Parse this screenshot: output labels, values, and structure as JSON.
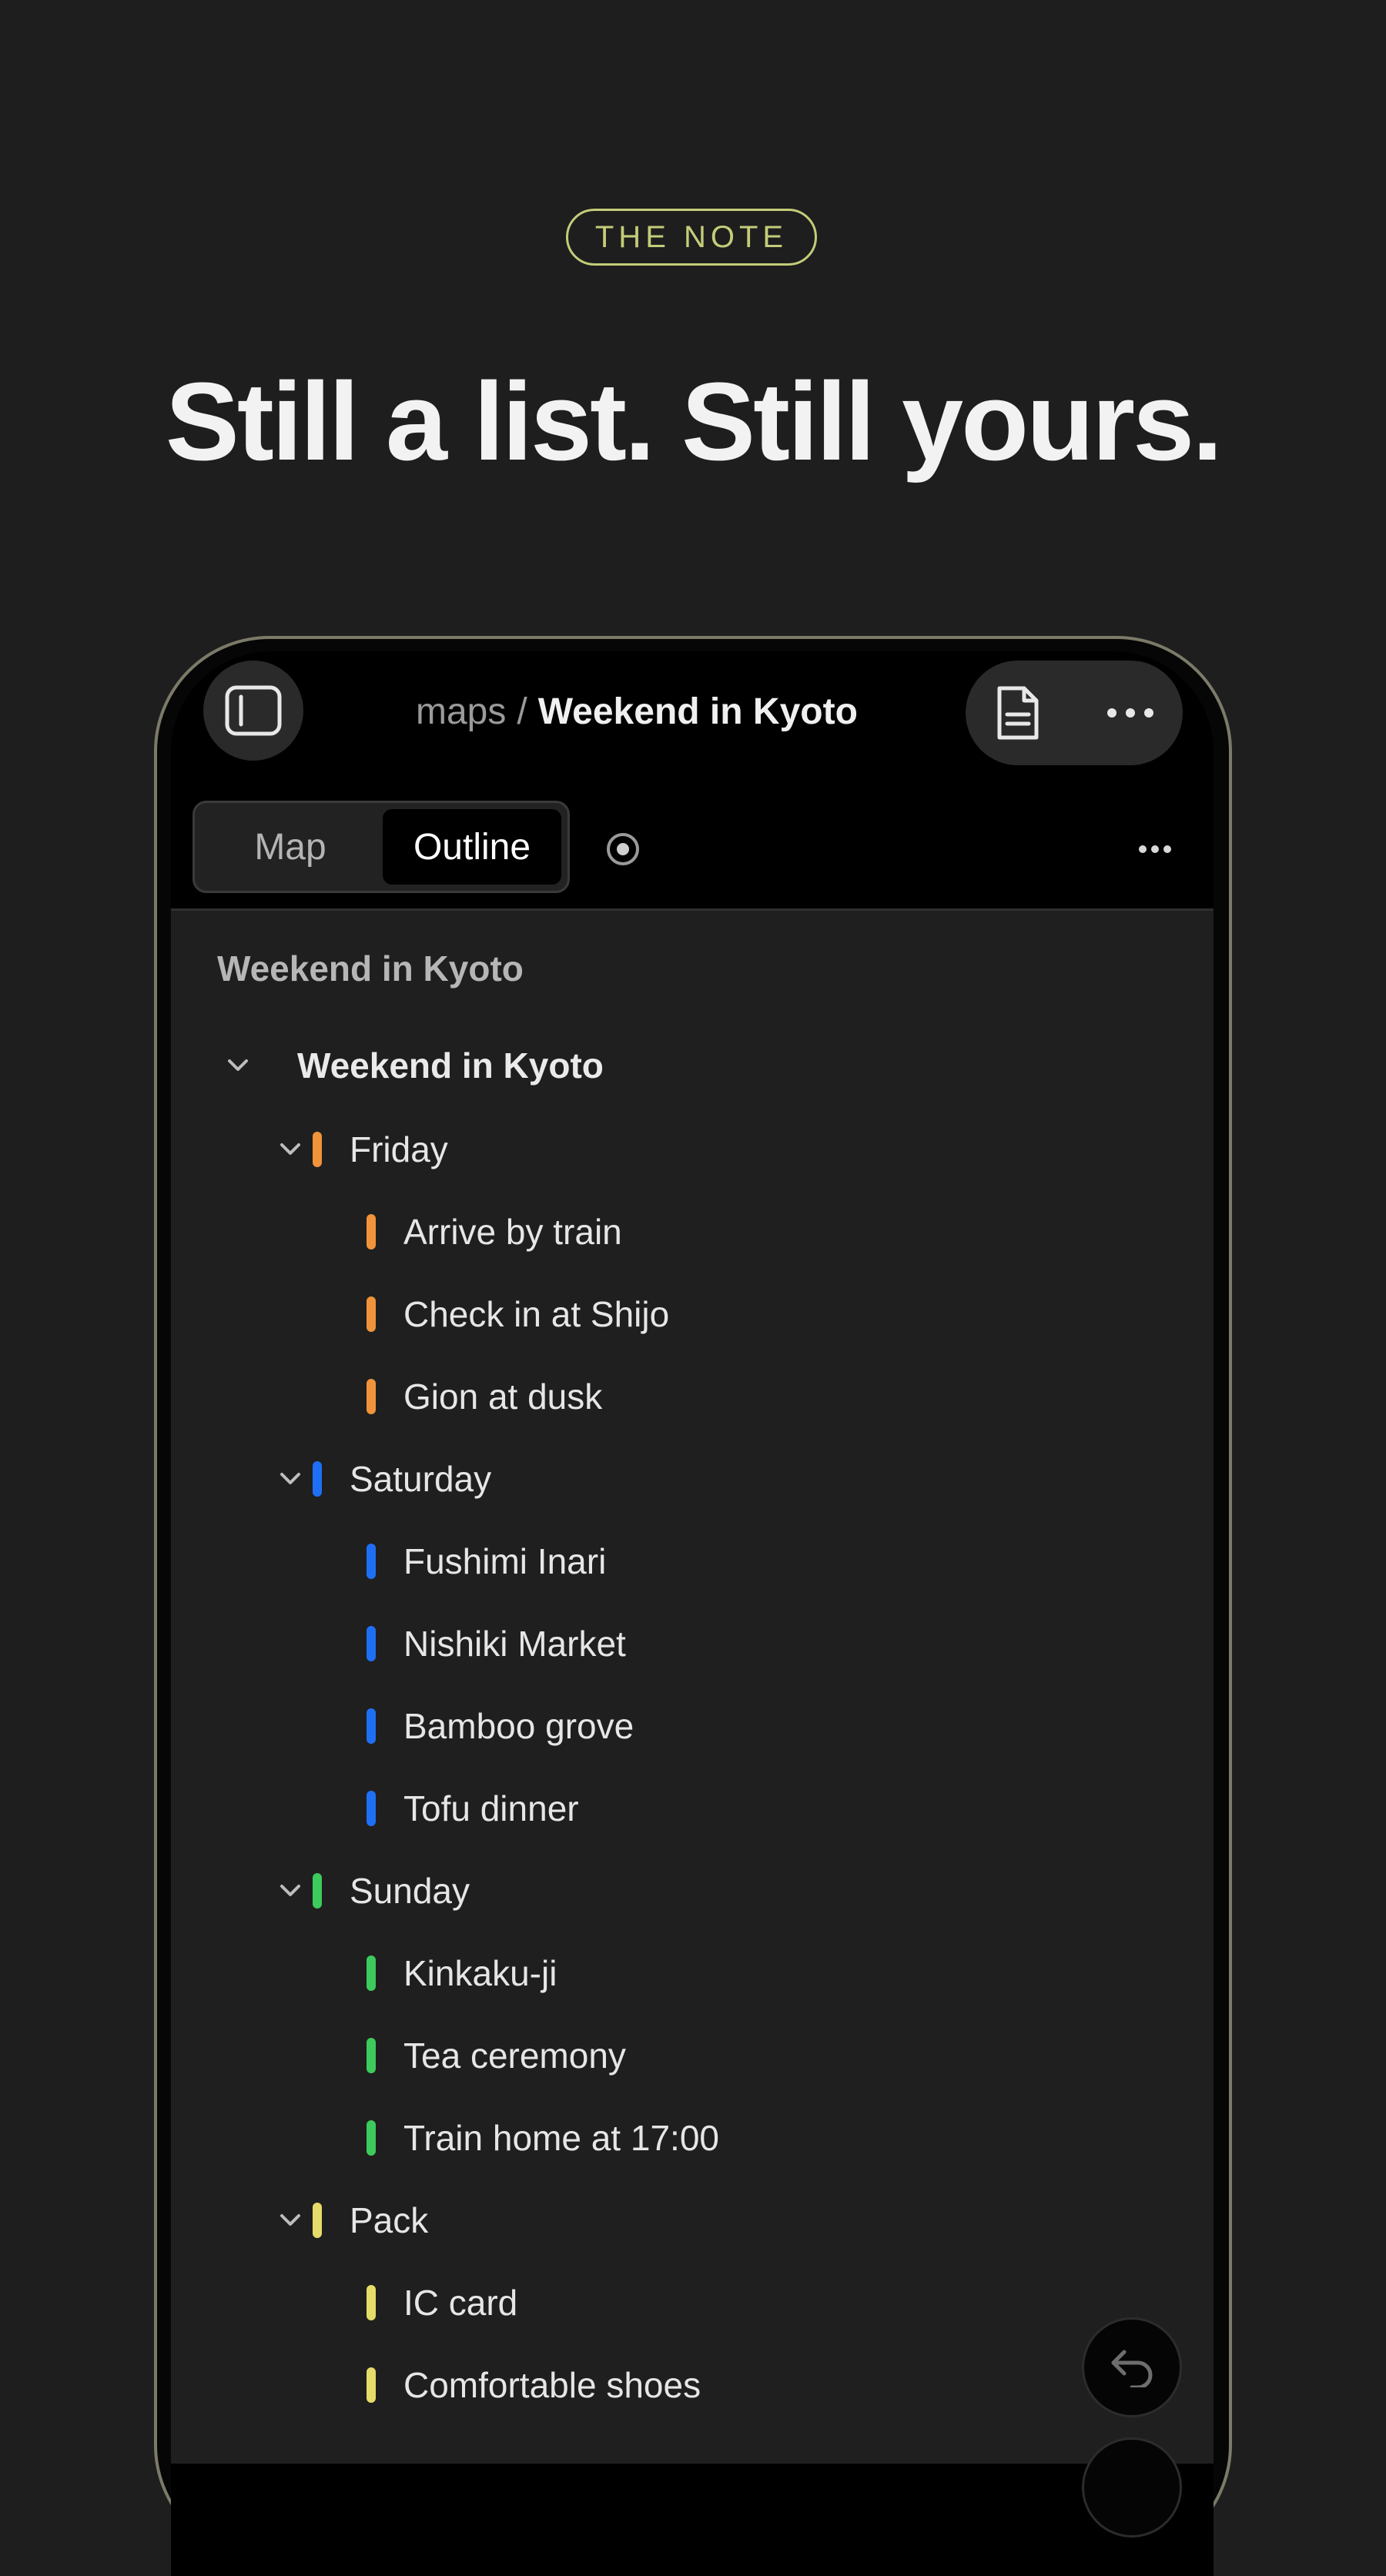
{
  "header": {
    "badge": "THE NOTE",
    "headline": "Still a list. Still yours."
  },
  "nav": {
    "sidebar_icon": "sidebar-toggle-icon",
    "breadcrumb_parent": "maps",
    "breadcrumb_separator": "/",
    "breadcrumb_current": "Weekend in Kyoto",
    "document_icon": "document-icon",
    "more_icon": "ellipsis-icon"
  },
  "toolbar": {
    "tabs": [
      {
        "label": "Map",
        "selected": false
      },
      {
        "label": "Outline",
        "selected": true
      }
    ],
    "focus_icon": "focus-icon",
    "more_icon": "ellipsis-icon"
  },
  "colors": {
    "friday": "#f0933a",
    "saturday": "#1f6ff5",
    "sunday": "#3ccb5c",
    "pack": "#e6dc6a",
    "badge": "#c4cc78"
  },
  "outline": {
    "title": "Weekend in Kyoto",
    "root": "Weekend in Kyoto",
    "groups": [
      {
        "label": "Friday",
        "color": "#f0933a",
        "items": [
          "Arrive by train",
          "Check in at Shijo",
          "Gion at dusk"
        ]
      },
      {
        "label": "Saturday",
        "color": "#1f6ff5",
        "items": [
          "Fushimi Inari",
          "Nishiki Market",
          "Bamboo grove",
          "Tofu dinner"
        ]
      },
      {
        "label": "Sunday",
        "color": "#3ccb5c",
        "items": [
          "Kinkaku-ji",
          "Tea ceremony",
          "Train home at 17:00"
        ]
      },
      {
        "label": "Pack",
        "color": "#e6dc6a",
        "items": [
          "IC card",
          "Comfortable shoes"
        ]
      }
    ]
  },
  "fab": {
    "undo_icon": "undo-icon"
  }
}
